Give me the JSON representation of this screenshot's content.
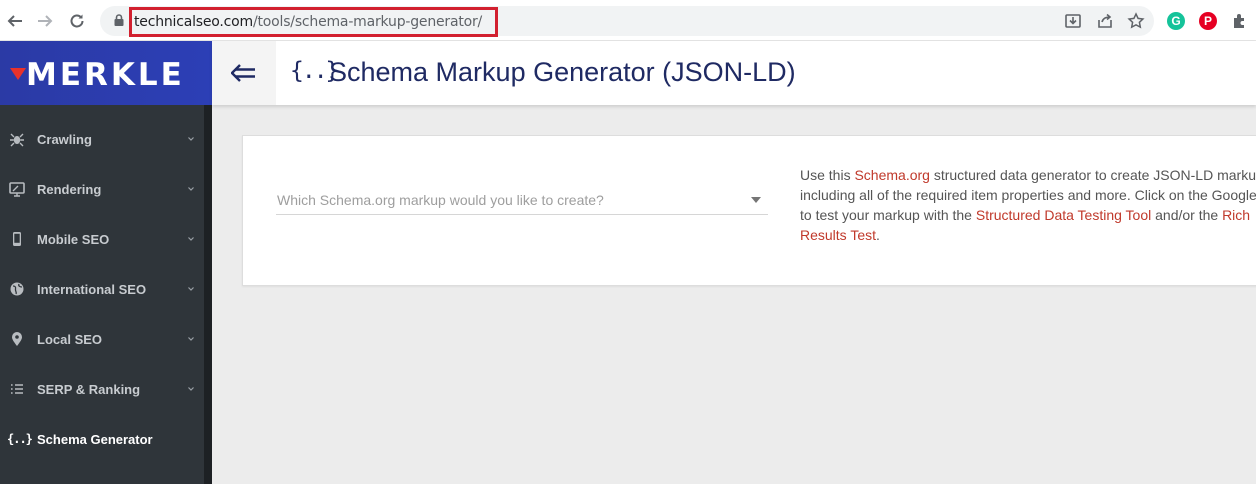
{
  "browser": {
    "url_domain": "technicalseo.com",
    "url_path": "/tools/schema-markup-generator/",
    "extensions": [
      {
        "name": "grammarly-extension",
        "letter": "G",
        "color": "#15c39a"
      },
      {
        "name": "pinterest-extension",
        "letter": "P",
        "color": "#e60023"
      }
    ]
  },
  "logo": {
    "text": "MERKLE"
  },
  "header": {
    "icon_text": "{..}",
    "title": "Schema Markup Generator (JSON-LD)"
  },
  "sidebar": {
    "items": [
      {
        "label": "Crawling",
        "icon": "spider-icon"
      },
      {
        "label": "Rendering",
        "icon": "monitor-icon"
      },
      {
        "label": "Mobile SEO",
        "icon": "mobile-icon"
      },
      {
        "label": "International SEO",
        "icon": "globe-icon"
      },
      {
        "label": "Local SEO",
        "icon": "map-pin-icon"
      },
      {
        "label": "SERP & Ranking",
        "icon": "list-icon"
      },
      {
        "label": "Schema Generator",
        "icon": "braces-icon",
        "icon_text": "{..}",
        "active": true
      }
    ]
  },
  "main": {
    "select_placeholder": "Which Schema.org markup would you like to create?",
    "description": {
      "l1_a": "Use this ",
      "l1_link": "Schema.org",
      "l1_b": " structured data generator to create JSON-LD markups,",
      "l2": "including all of the required item properties and more. Click on the Google icon",
      "l3_a": "to test your markup with the ",
      "l3_link": "Structured Data Testing Tool",
      "l3_b": " and/or the ",
      "l3_link2": "Rich",
      "l4_link": "Results Test",
      "l4_b": "."
    }
  },
  "colors": {
    "brand_blue": "#2c3fb6",
    "title_navy": "#1f2a63",
    "link_red": "#c0392b",
    "sidebar_bg": "#2f353a",
    "highlight_red": "#d2202f"
  }
}
